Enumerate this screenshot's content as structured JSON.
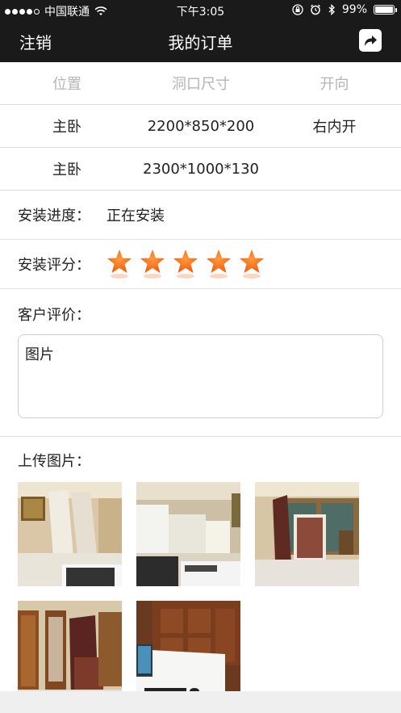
{
  "status_bar": {
    "carrier": "中国联通",
    "time": "下午3:05",
    "battery": "99%",
    "battery_level": 0.99
  },
  "navbar": {
    "left_label": "注销",
    "title": "我的订单",
    "right_icon": "share-icon"
  },
  "table": {
    "headers": [
      "位置",
      "洞口尺寸",
      "开向"
    ],
    "rows": [
      [
        "主卧",
        "2200*850*200",
        "右内开"
      ],
      [
        "主卧",
        "2300*1000*130",
        ""
      ]
    ]
  },
  "progress": {
    "label": "安装进度：",
    "value": "正在安装"
  },
  "rating": {
    "label": "安装评分：",
    "stars": 5,
    "max_stars": 5,
    "star_color": "#f25c0a"
  },
  "review": {
    "label": "客户评价：",
    "text": "图片"
  },
  "upload": {
    "label": "上传图片：",
    "photos": [
      "photo-1",
      "photo-2",
      "photo-3",
      "photo-4",
      "photo-5"
    ]
  },
  "colors": {
    "bar": "#1a1a1a",
    "divider": "#dcdcdc",
    "muted_text": "#b5b5b5"
  }
}
